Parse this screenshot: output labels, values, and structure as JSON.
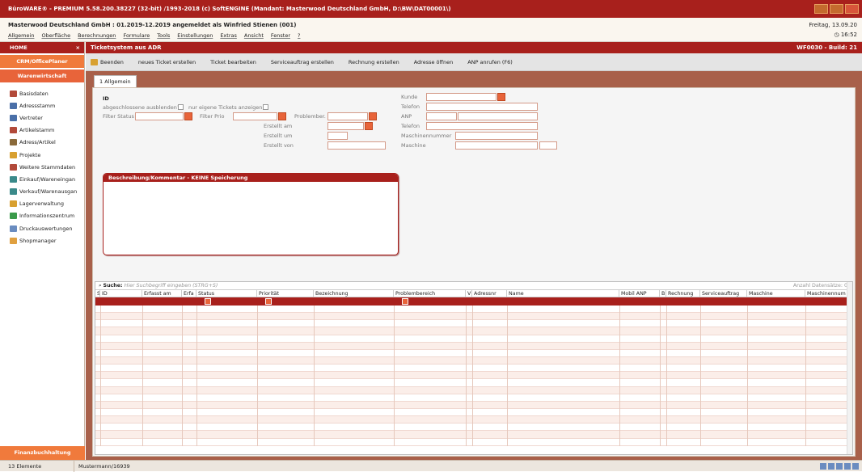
{
  "window": {
    "title": "BüroWARE® - PREMIUM  5.58.200.38227 (32-bit) /1993-2018 (c) SoftENGINE  (Mandant: Masterwood Deutschland GmbH, D:\\BW\\DAT00001\\)"
  },
  "info": {
    "mandant_line": "Masterwood Deutschland GmbH : 01.2019-12.2019 angemeldet als Winfried Stienen (001)",
    "date": "Freitag, 13.09.20",
    "time": "16:52",
    "menu": [
      "Allgemein",
      "Oberfläche",
      "Berechnungen",
      "Formulare",
      "Tools",
      "Einstellungen",
      "Extras",
      "Ansicht",
      "Fenster",
      "?"
    ]
  },
  "sidebar": {
    "home": "HOME",
    "close": "×",
    "crm": "CRM/OfficePlaner",
    "waren": "Warenwirtschaft",
    "items": [
      {
        "label": "Basisdaten",
        "color": "#b24a3a"
      },
      {
        "label": "Adressstamm",
        "color": "#4a6fa8"
      },
      {
        "label": "Vertreter",
        "color": "#4a6fa8"
      },
      {
        "label": "Artikelstamm",
        "color": "#b24a3a"
      },
      {
        "label": "Adress/Artikel",
        "color": "#8a6a3a"
      },
      {
        "label": "Projekte",
        "color": "#d8a030"
      },
      {
        "label": "Weitere Stammdaten",
        "color": "#b24a3a"
      },
      {
        "label": "Einkauf/Wareneingan",
        "color": "#3a8a8a"
      },
      {
        "label": "Verkauf/Warenausgan",
        "color": "#3a8a8a"
      },
      {
        "label": "Lagerverwaltung",
        "color": "#d8a030"
      },
      {
        "label": "Informationszentrum",
        "color": "#3a9a4a"
      },
      {
        "label": "Druckauswertungen",
        "color": "#6a8cc0"
      },
      {
        "label": "Shopmanager",
        "color": "#e0a040"
      }
    ],
    "fin": "Finanzbuchhaltung"
  },
  "header": {
    "title": "Ticketsystem aus ADR",
    "build": "WF0030 - Build: 21"
  },
  "toolbar": [
    "Beenden",
    "neues Ticket erstellen",
    "Ticket bearbeiten",
    "Serviceauftrag erstellen",
    "Rechnung erstellen",
    "Adresse öffnen",
    "ANP anrufen (F6)"
  ],
  "tab": "1 Allgemein",
  "form": {
    "id_label": "ID",
    "abgeschlossene": "abgeschlossene ausblenden?",
    "eigene": "nur eigene Tickets anzeigen",
    "filter_status": "Filter Status",
    "filter_prio": "Filter Prio",
    "problember": "Problember.",
    "erstellt_am": "Erstellt am",
    "erstellt_um": "Erstellt um",
    "erstellt_von": "Erstellt von",
    "kunde": "Kunde",
    "telefon": "Telefon",
    "anp": "ANP",
    "telefon2": "Telefon",
    "maschinennummer": "Maschinennummer",
    "maschine": "Maschine"
  },
  "desc": {
    "title": "Beschreibung/Kommentar - KEINE Speicherung"
  },
  "grid": {
    "search_label": "Suche:",
    "search_placeholder": "Hier Suchbegriff eingeben (STRG+S)",
    "count": "Anzahl Datensätze: 0",
    "columns": [
      "S",
      "ID",
      "Erfasst am",
      "Erfa",
      "Status",
      "Priorität",
      "Bezeichnung",
      "Problembereich",
      "V",
      "Adressnr",
      "Name",
      "Mobil ANP",
      "B",
      "Rechnung",
      "Serviceauftrag",
      "Maschine",
      "Maschinennum"
    ]
  },
  "status": {
    "left": "13 Elemente",
    "user": "Mustermann/16939"
  }
}
